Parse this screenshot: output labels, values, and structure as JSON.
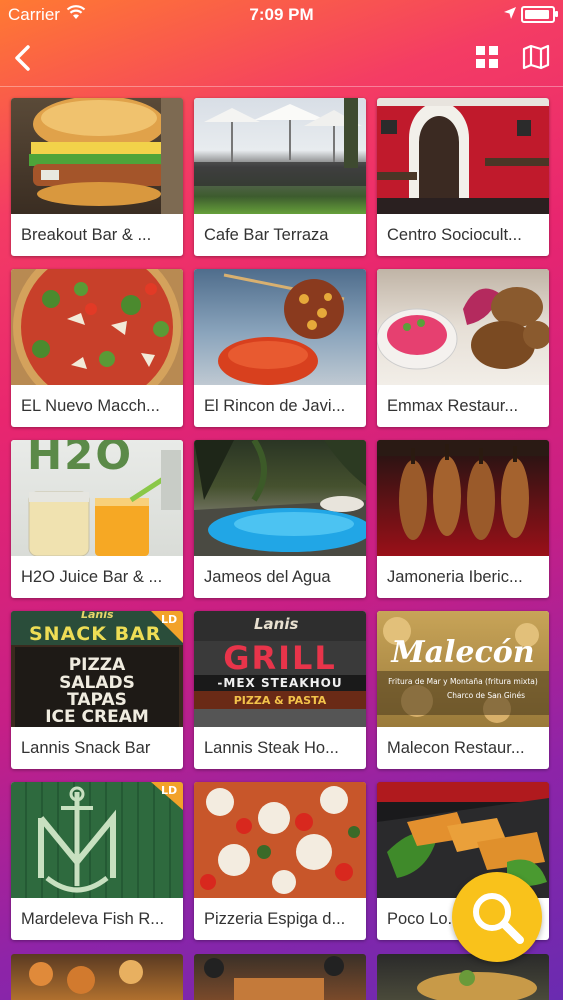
{
  "status_bar": {
    "carrier": "Carrier",
    "time": "7:09 PM"
  },
  "nav": {
    "back_icon": "chevron-left-icon",
    "grid_icon": "grid-view-icon",
    "map_icon": "map-icon"
  },
  "places": [
    {
      "name": "Breakout Bar & ..."
    },
    {
      "name": "Cafe Bar Terraza"
    },
    {
      "name": "Centro Sociocult..."
    },
    {
      "name": "EL Nuevo Macch..."
    },
    {
      "name": "El Rincon de Javi..."
    },
    {
      "name": "Emmax Restaur..."
    },
    {
      "name": "H2O Juice Bar & ..."
    },
    {
      "name": "Jameos del Agua"
    },
    {
      "name": "Jamoneria Iberic..."
    },
    {
      "name": "Lannis Snack Bar"
    },
    {
      "name": "Lannis Steak Ho..."
    },
    {
      "name": "Malecon Restaur..."
    },
    {
      "name": "Mardeleva Fish R..."
    },
    {
      "name": "Pizzeria Espiga d..."
    },
    {
      "name": "Poco Lo..."
    }
  ],
  "photo_text": {
    "h2o": "H2O",
    "snack_brand": "Lanis",
    "snack_sign_1": "SNACK BAR",
    "snack_sign_2": "PIZZA",
    "snack_sign_3": "SALADS",
    "snack_sign_4": "TAPAS",
    "snack_sign_5": "ICE CREAM",
    "steak_brand": "Lanis",
    "steak_sign_1": "GRILL",
    "steak_sign_2": "-MEX STEAKHOU",
    "steak_sign_3": "PIZZA & PASTA",
    "malecon_title": "Malecón",
    "malecon_sub": "Fritura de Mar y Montaña (fritura mixta)",
    "malecon_loc": "Charco de San Ginés",
    "sold_1": "LD",
    "sold_2": "LD"
  },
  "fab": {
    "icon": "search-icon"
  },
  "colors": {
    "accent": "#f9c21b",
    "gradient_top": "#ff7a32",
    "gradient_mid": "#e8266f",
    "gradient_bottom": "#6a2bb0"
  }
}
